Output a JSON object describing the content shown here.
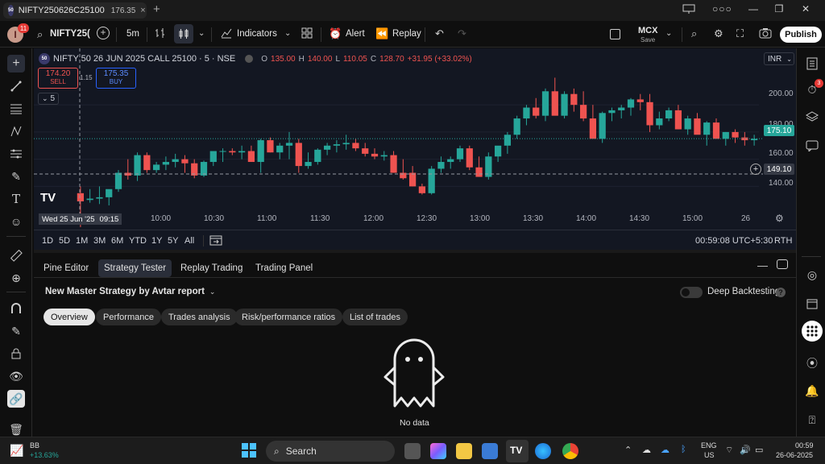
{
  "tab": {
    "logo": "50",
    "symbol": "NIFTY250626C25100",
    "price": "176.35",
    "close": "×",
    "new": "+"
  },
  "window": {
    "icons": [
      "layout-icon",
      "more-icon",
      "minimize-icon",
      "restore-icon",
      "close-icon"
    ]
  },
  "toolbar": {
    "avatar_letter": "I",
    "notif_count": "11",
    "symbol": "NIFTY25(",
    "interval": "5m",
    "indicators": "Indicators",
    "alert": "Alert",
    "replay": "Replay",
    "exchange": "MCX",
    "save": "Save",
    "publish": "Publish"
  },
  "chart": {
    "title": "NIFTY 50 26 JUN 2025 CALL 25100 · 5 · NSE",
    "o_label": "O",
    "o": "135.00",
    "h_label": "H",
    "h": "140.00",
    "l_label": "L",
    "l": "110.05",
    "c_label": "C",
    "c": "128.70",
    "change": "+31.95 (+33.02%)",
    "sell_price": "174.20",
    "sell": "SELL",
    "spread": "1.15",
    "buy_price": "175.35",
    "buy": "BUY",
    "collapse_count": "5",
    "currency": "INR",
    "crosshair_date": "Wed 25 Jun '25",
    "crosshair_time": "09:15",
    "last_price": "175.10",
    "cursor_price": "149.10",
    "y_ticks": [
      "200.00",
      "180.00",
      "160.00",
      "140.00"
    ],
    "x_ticks": [
      "10:00",
      "10:30",
      "11:00",
      "11:30",
      "12:00",
      "12:30",
      "13:00",
      "13:30",
      "14:00",
      "14:30",
      "15:00",
      "26"
    ]
  },
  "chart_data": {
    "type": "candlestick",
    "ylim": [
      126,
      225
    ],
    "up_color": "#26a69a",
    "down_color": "#ef5350",
    "candles": [
      [
        135,
        140,
        110,
        129
      ],
      [
        130,
        138,
        128,
        131
      ],
      [
        131,
        140,
        127,
        132
      ],
      [
        132,
        135,
        126,
        138
      ],
      [
        138,
        152,
        136,
        150
      ],
      [
        150,
        160,
        145,
        148
      ],
      [
        148,
        165,
        144,
        163
      ],
      [
        163,
        165,
        150,
        152
      ],
      [
        152,
        158,
        150,
        156
      ],
      [
        156,
        162,
        152,
        158
      ],
      [
        158,
        164,
        154,
        160
      ],
      [
        160,
        163,
        150,
        157
      ],
      [
        157,
        160,
        146,
        148
      ],
      [
        148,
        159,
        147,
        158
      ],
      [
        158,
        165,
        155,
        166
      ],
      [
        166,
        168,
        158,
        166
      ],
      [
        166,
        168,
        163,
        165
      ],
      [
        165,
        170,
        160,
        166
      ],
      [
        166,
        170,
        160,
        158
      ],
      [
        158,
        175,
        150,
        174
      ],
      [
        174,
        176,
        165,
        165
      ],
      [
        165,
        172,
        160,
        170
      ],
      [
        170,
        180,
        160,
        172
      ],
      [
        172,
        175,
        150,
        155
      ],
      [
        155,
        165,
        153,
        158
      ],
      [
        158,
        168,
        156,
        167
      ],
      [
        167,
        172,
        163,
        170
      ],
      [
        170,
        174,
        165,
        171
      ],
      [
        171,
        178,
        167,
        172
      ],
      [
        172,
        175,
        166,
        168
      ],
      [
        168,
        172,
        162,
        164
      ],
      [
        164,
        168,
        160,
        162
      ],
      [
        162,
        166,
        159,
        163
      ],
      [
        163,
        166,
        150,
        150
      ],
      [
        150,
        160,
        145,
        146
      ],
      [
        150,
        155,
        140,
        140
      ],
      [
        140,
        142,
        134,
        135
      ],
      [
        135,
        155,
        134,
        153
      ],
      [
        153,
        162,
        150,
        158
      ],
      [
        158,
        162,
        153,
        160
      ],
      [
        160,
        170,
        158,
        168
      ],
      [
        168,
        170,
        152,
        154
      ],
      [
        154,
        162,
        150,
        147
      ],
      [
        147,
        165,
        145,
        162
      ],
      [
        162,
        168,
        158,
        170
      ],
      [
        170,
        180,
        164,
        178
      ],
      [
        178,
        192,
        175,
        190
      ],
      [
        190,
        200,
        185,
        198
      ],
      [
        198,
        205,
        190,
        192
      ],
      [
        192,
        212,
        188,
        210
      ],
      [
        210,
        220,
        195,
        192
      ],
      [
        192,
        210,
        190,
        208
      ],
      [
        208,
        212,
        195,
        200
      ],
      [
        200,
        210,
        188,
        190
      ],
      [
        190,
        200,
        180,
        175
      ],
      [
        175,
        195,
        172,
        194
      ],
      [
        194,
        198,
        188,
        196
      ],
      [
        196,
        200,
        190,
        198
      ],
      [
        198,
        205,
        192,
        204
      ],
      [
        204,
        208,
        196,
        202
      ],
      [
        202,
        208,
        180,
        185
      ],
      [
        185,
        195,
        182,
        190
      ],
      [
        190,
        198,
        188,
        196
      ],
      [
        196,
        200,
        182,
        182
      ],
      [
        182,
        192,
        178,
        190
      ],
      [
        190,
        194,
        180,
        178
      ],
      [
        178,
        188,
        170,
        187
      ],
      [
        187,
        190,
        180,
        175
      ],
      [
        175,
        180,
        170,
        180
      ],
      [
        180,
        182,
        172,
        176
      ],
      [
        176,
        180,
        170,
        174
      ],
      [
        174,
        178,
        170,
        175
      ]
    ]
  },
  "ranges": {
    "items": [
      "1D",
      "5D",
      "1M",
      "3M",
      "6M",
      "YTD",
      "1Y",
      "5Y",
      "All"
    ],
    "time": "00:59:08 UTC+5:30",
    "rth": "RTH"
  },
  "panel": {
    "tabs": [
      "Pine Editor",
      "Strategy Tester",
      "Replay Trading",
      "Trading Panel"
    ],
    "strategy": "New Master Strategy by Avtar report",
    "deep": "Deep Backtesting",
    "subtabs": [
      "Overview",
      "Performance",
      "Trades analysis",
      "Risk/performance ratios",
      "List of trades"
    ],
    "empty": "No data"
  },
  "taskbar": {
    "ticker": "BB",
    "change": "+13.63%",
    "search": "Search",
    "lang1": "ENG",
    "lang2": "US",
    "time": "00:59",
    "date": "26-06-2025"
  }
}
